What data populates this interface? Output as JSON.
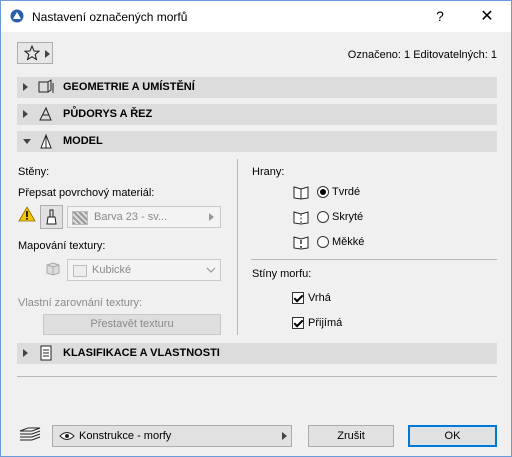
{
  "window": {
    "title": "Nastavení označených morfů",
    "help_label": "?",
    "close_label": "✕"
  },
  "header": {
    "selection_info": "Označeno: 1 Editovatelných: 1"
  },
  "sections": {
    "geometry": "GEOMETRIE A UMÍSTĚNÍ",
    "floorplan": "PŮDORYS A ŘEZ",
    "model": "MODEL",
    "classification": "KLASIFIKACE A VLASTNOSTI"
  },
  "model": {
    "walls_label": "Stěny:",
    "override_material_label": "Přepsat povrchový materiál:",
    "material_value": "Barva 23 - sv...",
    "texture_mapping_label": "Mapování textury:",
    "texture_mapping_value": "Kubické",
    "custom_alignment_label": "Vlastní zarovnání textury:",
    "rebuild_texture_label": "Přestavět texturu",
    "edges_label": "Hrany:",
    "edges": [
      {
        "label": "Tvrdé",
        "selected": true
      },
      {
        "label": "Skryté",
        "selected": false
      },
      {
        "label": "Měkké",
        "selected": false
      }
    ],
    "shadows_label": "Stíny morfu:",
    "shadows": [
      {
        "label": "Vrhá",
        "checked": true
      },
      {
        "label": "Přijímá",
        "checked": true
      }
    ]
  },
  "footer": {
    "layer_value": "Konstrukce - morfy",
    "cancel_label": "Zrušit",
    "ok_label": "OK"
  },
  "colors": {
    "accent": "#0078d7",
    "section_bg": "#dcdcdc",
    "warning": "#f5c400"
  }
}
